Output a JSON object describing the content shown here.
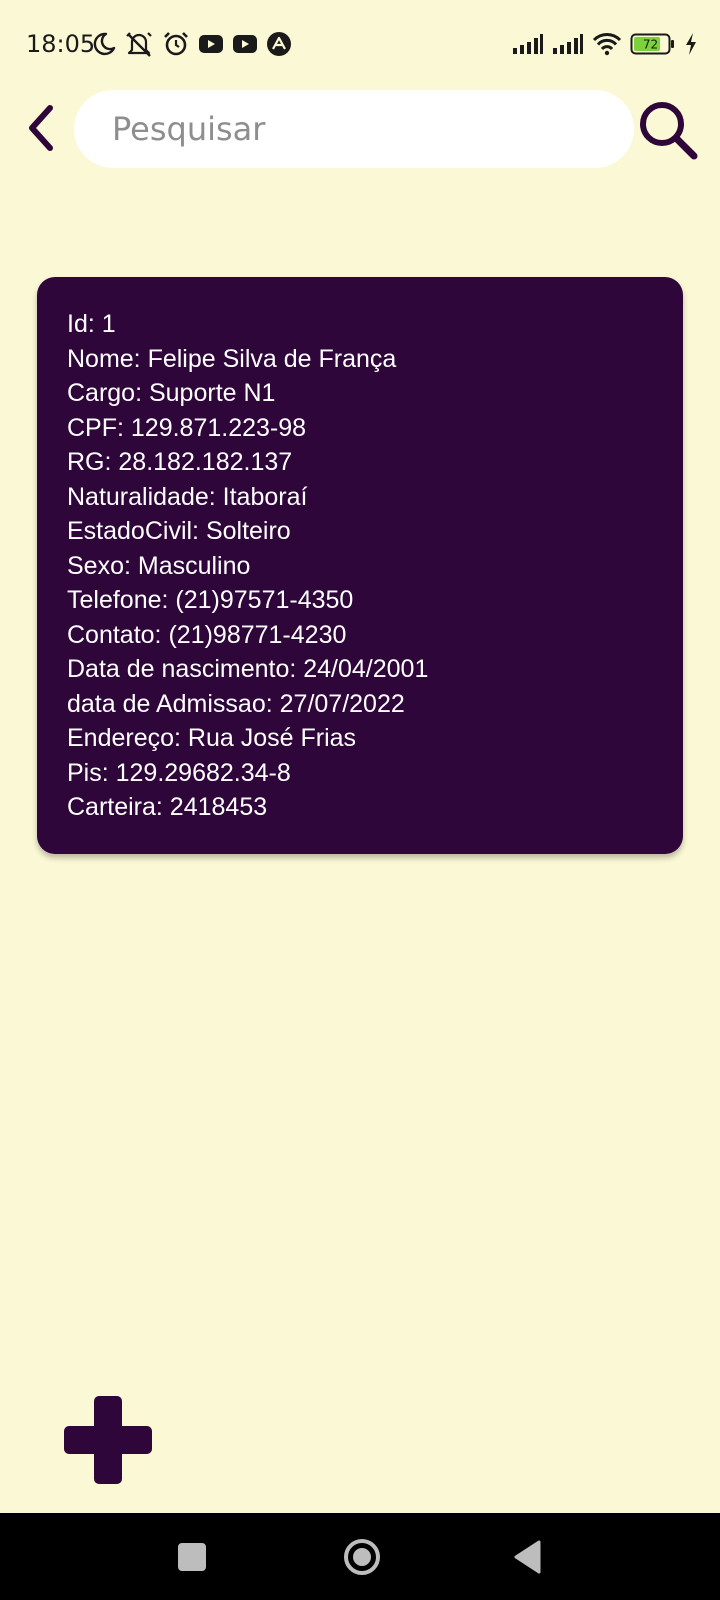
{
  "status_bar": {
    "time": "18:05",
    "battery": "72",
    "left_icons": [
      "moon-icon",
      "alarm-off-icon",
      "alarm-clock-icon",
      "youtube-icon",
      "youtube-icon",
      "app-notification-icon"
    ],
    "right_icons": [
      "signal-icon",
      "signal-icon",
      "wifi-icon",
      "battery-icon",
      "charging-icon"
    ]
  },
  "search": {
    "placeholder": "Pesquisar",
    "value": ""
  },
  "icons": {
    "back": "chevron-left-icon",
    "search": "search-icon",
    "add": "plus-icon"
  },
  "record": {
    "fields": [
      "Id: 1",
      "Nome: Felipe Silva de França",
      "Cargo: Suporte N1",
      "CPF: 129.871.223-98",
      "RG: 28.182.182.137",
      "Naturalidade: Itaboraí",
      "EstadoCivil: Solteiro",
      "Sexo: Masculino",
      "Telefone: (21)97571-4350",
      "Contato: (21)98771-4230",
      "Data de nascimento: 24/04/2001",
      "data de Admissao: 27/07/2022",
      "Endereço: Rua José Frias",
      "Pis: 129.29682.34-8",
      "Carteira: 2418453"
    ]
  },
  "colors": {
    "background": "#FBF8D6",
    "accent": "#2E063A",
    "card_text": "#FFFFFF",
    "search_field": "#FFFFFF",
    "battery_fill": "#7BD23B"
  }
}
